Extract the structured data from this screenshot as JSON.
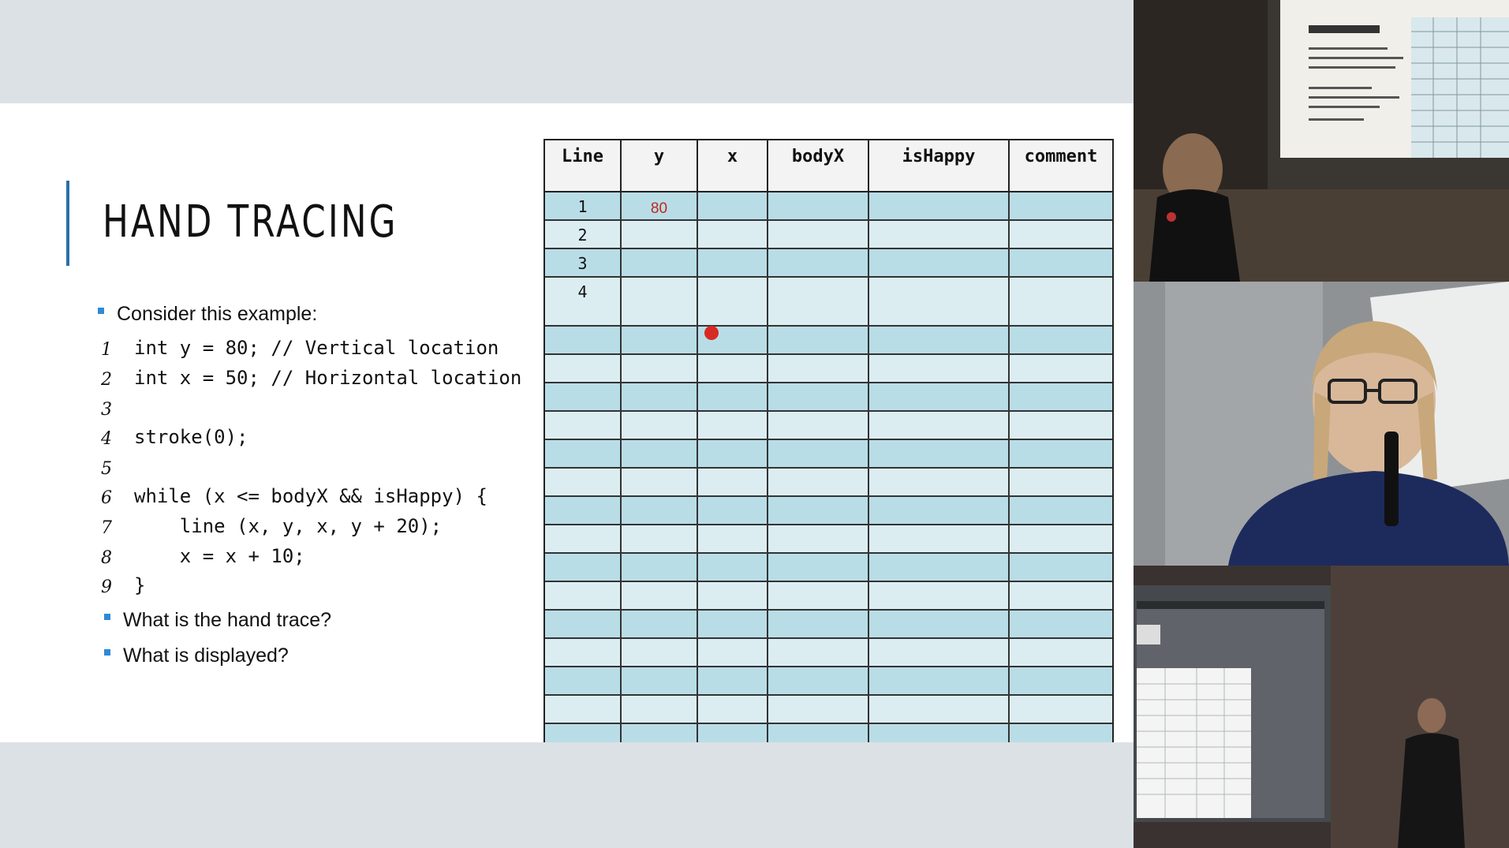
{
  "slide": {
    "title": "HAND TRACING",
    "intro_bullet": "Consider this example:",
    "code": [
      {
        "num": "1",
        "text": "int y = 80; // Vertical location"
      },
      {
        "num": "2",
        "text": "int x = 50; // Horizontal location"
      },
      {
        "num": "3",
        "text": ""
      },
      {
        "num": "4",
        "text": "stroke(0);"
      },
      {
        "num": "5",
        "text": ""
      },
      {
        "num": "6",
        "text": "while (x <= bodyX && isHappy) {"
      },
      {
        "num": "7",
        "text": "    line (x, y, x, y + 20);"
      },
      {
        "num": "8",
        "text": "    x = x + 10;"
      },
      {
        "num": "9",
        "text": "}"
      }
    ],
    "questions": [
      "What is the hand trace?",
      "What is displayed?"
    ]
  },
  "trace_table": {
    "headers": [
      "Line",
      "y",
      "x",
      "bodyX",
      "isHappy",
      "comment"
    ],
    "rows": [
      [
        "1",
        "80",
        "",
        "",
        "",
        ""
      ],
      [
        "2",
        "",
        "",
        "",
        "",
        ""
      ],
      [
        "3",
        "",
        "",
        "",
        "",
        ""
      ],
      [
        "4",
        "",
        "",
        "",
        "",
        ""
      ]
    ]
  },
  "colors": {
    "accent": "#2c6fa5",
    "bullet": "#2c8ad6",
    "table_dark": "#b9dde6",
    "table_light": "#dcedf2",
    "annotation_red": "#d62a22"
  }
}
